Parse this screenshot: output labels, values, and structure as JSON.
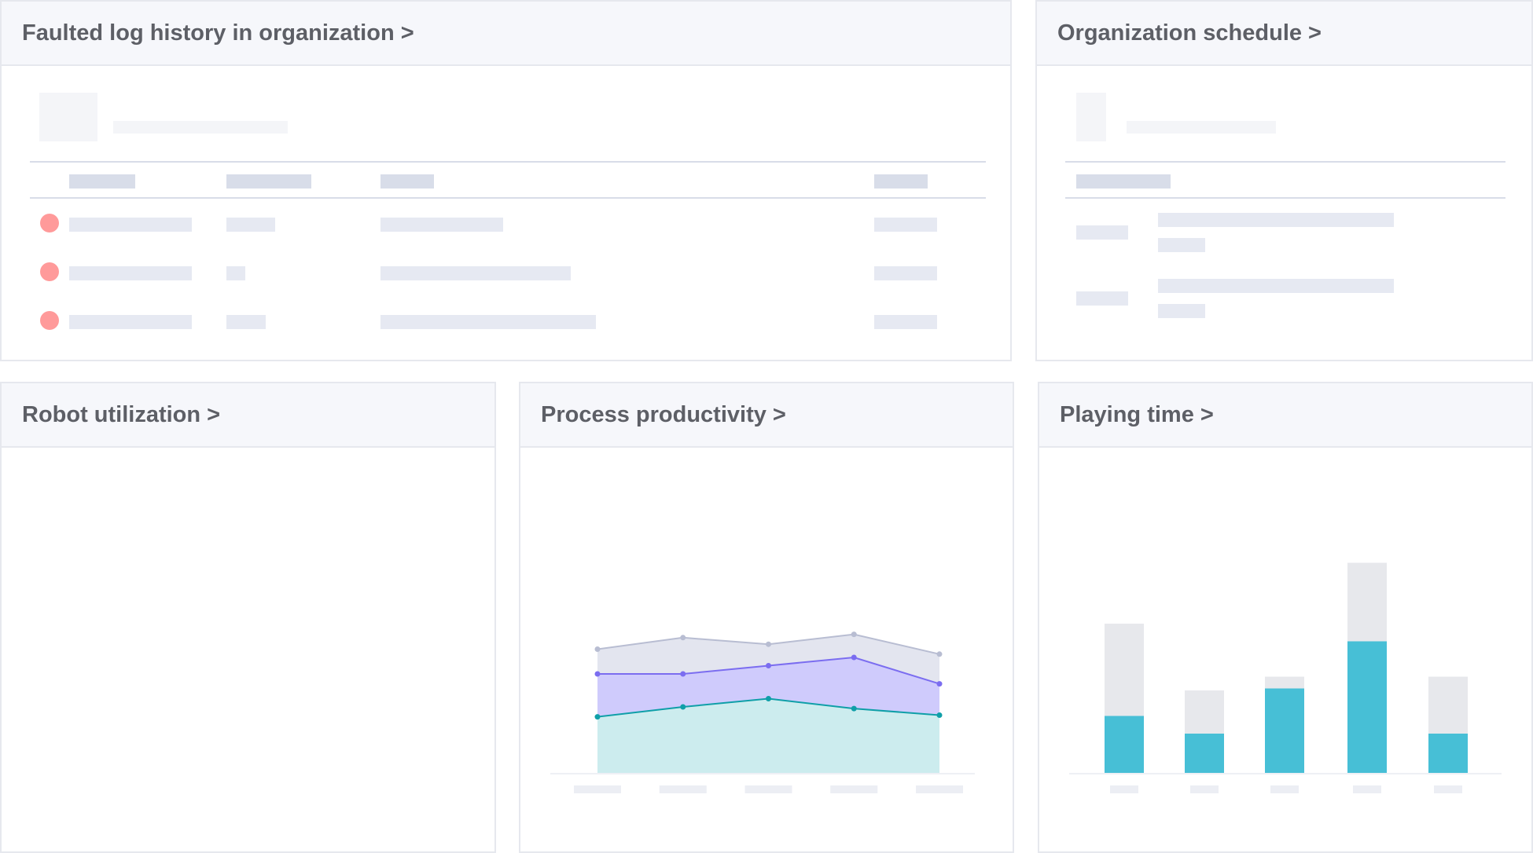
{
  "cards": {
    "faulted_log": {
      "title": "Faulted log history in organization >"
    },
    "schedule": {
      "title": "Organization schedule >"
    },
    "robot_utilization": {
      "title": "Robot utilization >"
    },
    "process_productivity": {
      "title": "Process productivity >"
    },
    "playing_time": {
      "title": "Playing time >"
    }
  },
  "colors": {
    "fault_dot": "#ff9a9a",
    "skeleton": "#e6e9f2",
    "series_gray": "#b8bdd2",
    "series_purple": "#7b6df0",
    "series_teal": "#0f9fa8",
    "bar_active": "#47bfd6",
    "bar_background": "#e7e8ec"
  },
  "chart_data": [
    {
      "type": "area",
      "series": [
        {
          "values": [
            75,
            82,
            78,
            84,
            72
          ]
        },
        {
          "values": [
            60,
            60,
            65,
            70,
            54
          ]
        },
        {
          "values": [
            34,
            40,
            45,
            39,
            35
          ]
        }
      ]
    },
    {
      "type": "bar",
      "stacked": true,
      "series": [
        {
          "values": [
            29,
            20,
            43,
            67,
            20
          ]
        },
        {
          "values": [
            47,
            22,
            6,
            40,
            29
          ]
        }
      ]
    }
  ]
}
